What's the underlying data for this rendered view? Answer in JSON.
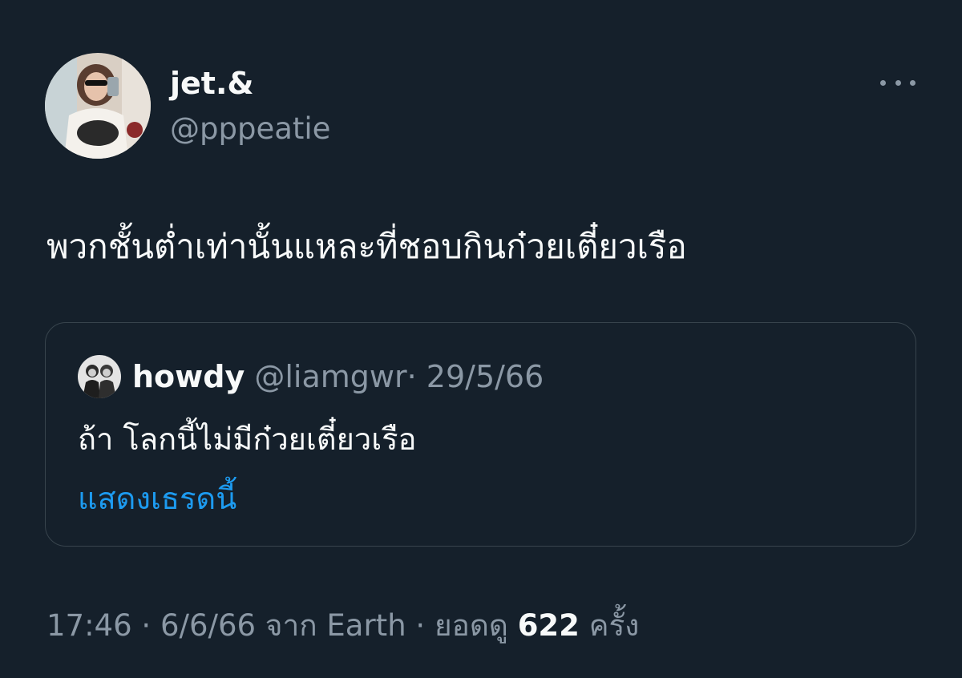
{
  "author": {
    "display_name": "jet.&",
    "handle": "@pppeatie"
  },
  "tweet": {
    "text": "พวกชั้นต่ำเท่านั้นแหละที่ชอบกินก๋วยเตี๋ยวเรือ"
  },
  "quoted": {
    "display_name": "howdy",
    "handle": "@liamgwr",
    "separator": "·",
    "date": "29/5/66",
    "text": "ถ้า โลกนี้ไม่มีก๋วยเตี๋ยวเรือ",
    "show_thread_label": "แสดงเธรดนี้"
  },
  "meta": {
    "time": "17:46",
    "separator": "·",
    "date": "6/6/66",
    "source_prefix": "จาก",
    "source": "Earth",
    "views_prefix": "ยอดดู",
    "views": "622",
    "views_suffix": "ครั้ง"
  },
  "icons": {
    "more": "more-horizontal-icon"
  },
  "colors": {
    "background": "#15202b",
    "primary_text": "#f7f9f9",
    "secondary_text": "#8b98a5",
    "link": "#1d9bf0",
    "border": "#38444d"
  }
}
